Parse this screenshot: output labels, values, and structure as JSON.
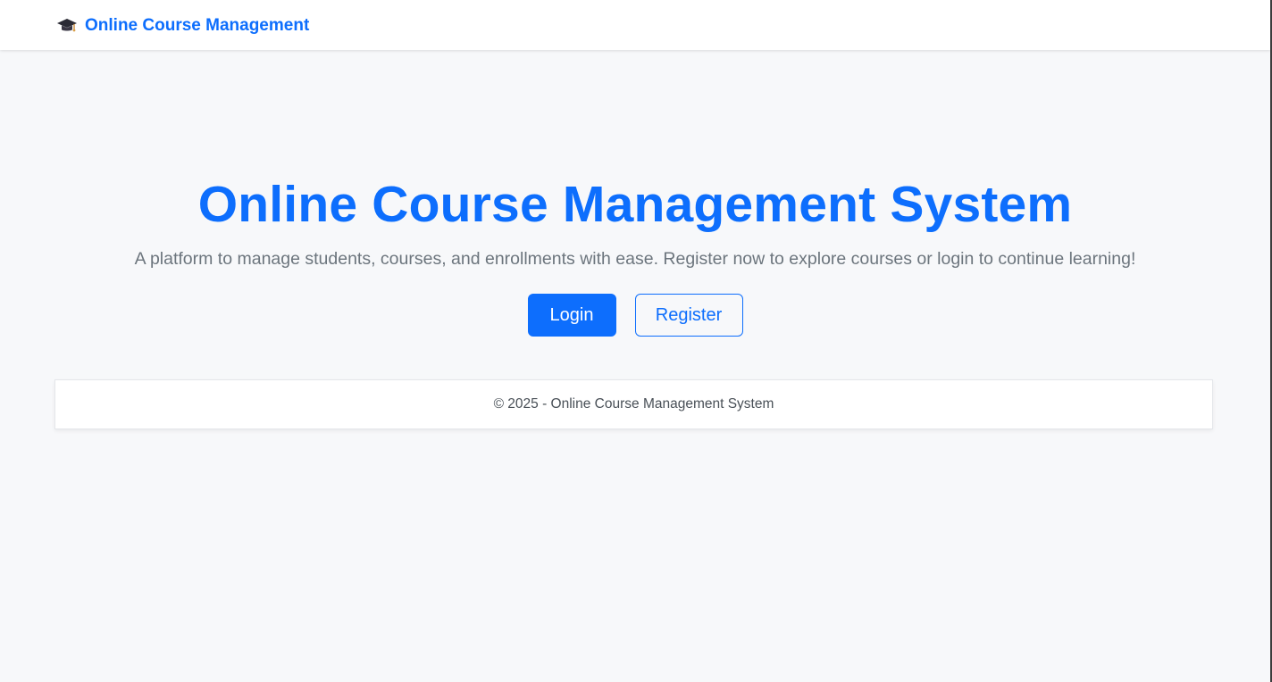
{
  "navbar": {
    "brand_icon": "graduation-cap-icon",
    "brand_text": "Online Course Management"
  },
  "hero": {
    "title": "Online Course Management System",
    "subtitle": "A platform to manage students, courses, and enrollments with ease. Register now to explore courses or login to continue learning!",
    "login_label": "Login",
    "register_label": "Register"
  },
  "footer": {
    "text": "© 2025 - Online Course Management System"
  },
  "colors": {
    "primary": "#0d6efd",
    "background": "#f7f8fa",
    "muted_text": "#6c757d"
  }
}
